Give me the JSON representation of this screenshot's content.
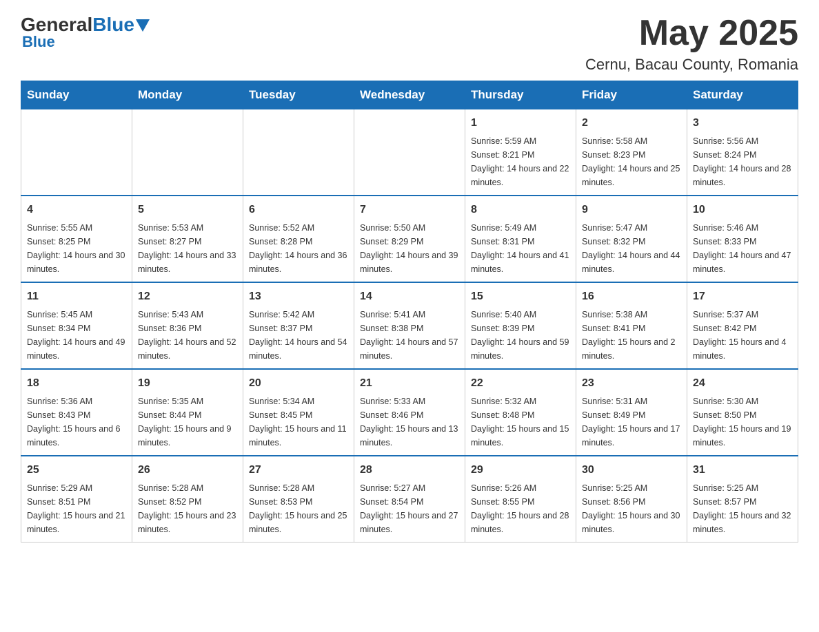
{
  "header": {
    "logo": {
      "general": "General",
      "blue": "Blue"
    },
    "title": "May 2025",
    "location": "Cernu, Bacau County, Romania"
  },
  "weekdays": [
    "Sunday",
    "Monday",
    "Tuesday",
    "Wednesday",
    "Thursday",
    "Friday",
    "Saturday"
  ],
  "weeks": [
    [
      {
        "day": "",
        "info": ""
      },
      {
        "day": "",
        "info": ""
      },
      {
        "day": "",
        "info": ""
      },
      {
        "day": "",
        "info": ""
      },
      {
        "day": "1",
        "info": "Sunrise: 5:59 AM\nSunset: 8:21 PM\nDaylight: 14 hours and 22 minutes."
      },
      {
        "day": "2",
        "info": "Sunrise: 5:58 AM\nSunset: 8:23 PM\nDaylight: 14 hours and 25 minutes."
      },
      {
        "day": "3",
        "info": "Sunrise: 5:56 AM\nSunset: 8:24 PM\nDaylight: 14 hours and 28 minutes."
      }
    ],
    [
      {
        "day": "4",
        "info": "Sunrise: 5:55 AM\nSunset: 8:25 PM\nDaylight: 14 hours and 30 minutes."
      },
      {
        "day": "5",
        "info": "Sunrise: 5:53 AM\nSunset: 8:27 PM\nDaylight: 14 hours and 33 minutes."
      },
      {
        "day": "6",
        "info": "Sunrise: 5:52 AM\nSunset: 8:28 PM\nDaylight: 14 hours and 36 minutes."
      },
      {
        "day": "7",
        "info": "Sunrise: 5:50 AM\nSunset: 8:29 PM\nDaylight: 14 hours and 39 minutes."
      },
      {
        "day": "8",
        "info": "Sunrise: 5:49 AM\nSunset: 8:31 PM\nDaylight: 14 hours and 41 minutes."
      },
      {
        "day": "9",
        "info": "Sunrise: 5:47 AM\nSunset: 8:32 PM\nDaylight: 14 hours and 44 minutes."
      },
      {
        "day": "10",
        "info": "Sunrise: 5:46 AM\nSunset: 8:33 PM\nDaylight: 14 hours and 47 minutes."
      }
    ],
    [
      {
        "day": "11",
        "info": "Sunrise: 5:45 AM\nSunset: 8:34 PM\nDaylight: 14 hours and 49 minutes."
      },
      {
        "day": "12",
        "info": "Sunrise: 5:43 AM\nSunset: 8:36 PM\nDaylight: 14 hours and 52 minutes."
      },
      {
        "day": "13",
        "info": "Sunrise: 5:42 AM\nSunset: 8:37 PM\nDaylight: 14 hours and 54 minutes."
      },
      {
        "day": "14",
        "info": "Sunrise: 5:41 AM\nSunset: 8:38 PM\nDaylight: 14 hours and 57 minutes."
      },
      {
        "day": "15",
        "info": "Sunrise: 5:40 AM\nSunset: 8:39 PM\nDaylight: 14 hours and 59 minutes."
      },
      {
        "day": "16",
        "info": "Sunrise: 5:38 AM\nSunset: 8:41 PM\nDaylight: 15 hours and 2 minutes."
      },
      {
        "day": "17",
        "info": "Sunrise: 5:37 AM\nSunset: 8:42 PM\nDaylight: 15 hours and 4 minutes."
      }
    ],
    [
      {
        "day": "18",
        "info": "Sunrise: 5:36 AM\nSunset: 8:43 PM\nDaylight: 15 hours and 6 minutes."
      },
      {
        "day": "19",
        "info": "Sunrise: 5:35 AM\nSunset: 8:44 PM\nDaylight: 15 hours and 9 minutes."
      },
      {
        "day": "20",
        "info": "Sunrise: 5:34 AM\nSunset: 8:45 PM\nDaylight: 15 hours and 11 minutes."
      },
      {
        "day": "21",
        "info": "Sunrise: 5:33 AM\nSunset: 8:46 PM\nDaylight: 15 hours and 13 minutes."
      },
      {
        "day": "22",
        "info": "Sunrise: 5:32 AM\nSunset: 8:48 PM\nDaylight: 15 hours and 15 minutes."
      },
      {
        "day": "23",
        "info": "Sunrise: 5:31 AM\nSunset: 8:49 PM\nDaylight: 15 hours and 17 minutes."
      },
      {
        "day": "24",
        "info": "Sunrise: 5:30 AM\nSunset: 8:50 PM\nDaylight: 15 hours and 19 minutes."
      }
    ],
    [
      {
        "day": "25",
        "info": "Sunrise: 5:29 AM\nSunset: 8:51 PM\nDaylight: 15 hours and 21 minutes."
      },
      {
        "day": "26",
        "info": "Sunrise: 5:28 AM\nSunset: 8:52 PM\nDaylight: 15 hours and 23 minutes."
      },
      {
        "day": "27",
        "info": "Sunrise: 5:28 AM\nSunset: 8:53 PM\nDaylight: 15 hours and 25 minutes."
      },
      {
        "day": "28",
        "info": "Sunrise: 5:27 AM\nSunset: 8:54 PM\nDaylight: 15 hours and 27 minutes."
      },
      {
        "day": "29",
        "info": "Sunrise: 5:26 AM\nSunset: 8:55 PM\nDaylight: 15 hours and 28 minutes."
      },
      {
        "day": "30",
        "info": "Sunrise: 5:25 AM\nSunset: 8:56 PM\nDaylight: 15 hours and 30 minutes."
      },
      {
        "day": "31",
        "info": "Sunrise: 5:25 AM\nSunset: 8:57 PM\nDaylight: 15 hours and 32 minutes."
      }
    ]
  ]
}
